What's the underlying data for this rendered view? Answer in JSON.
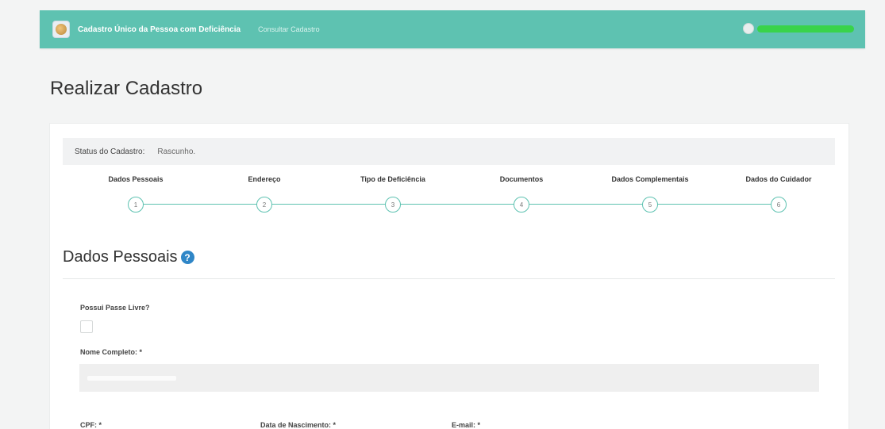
{
  "navbar": {
    "brand": "Cadastro Único da Pessoa com Deficiência",
    "link_consultar": "Consultar Cadastro",
    "user_name": ""
  },
  "page": {
    "title": "Realizar Cadastro"
  },
  "status": {
    "label": "Status do Cadastro:",
    "value": "Rascunho."
  },
  "steps": [
    {
      "label": "Dados Pessoais",
      "number": "1"
    },
    {
      "label": "Endereço",
      "number": "2"
    },
    {
      "label": "Tipo de Deficiência",
      "number": "3"
    },
    {
      "label": "Documentos",
      "number": "4"
    },
    {
      "label": "Dados Complementais",
      "number": "5"
    },
    {
      "label": "Dados do Cuidador",
      "number": "6"
    }
  ],
  "section": {
    "title": "Dados Pessoais",
    "help_icon": "question-circle-icon"
  },
  "form": {
    "passe_livre_label": "Possui Passe Livre?",
    "nome_label": "Nome Completo: *",
    "nome_value": "",
    "cpf_label": "CPF: *",
    "nascimento_label": "Data de Nascimento: *",
    "email_label": "E-mail: *"
  },
  "colors": {
    "accent": "#5ec2b1",
    "help_icon": "#2f86c7",
    "background": "#f3f4f4"
  }
}
